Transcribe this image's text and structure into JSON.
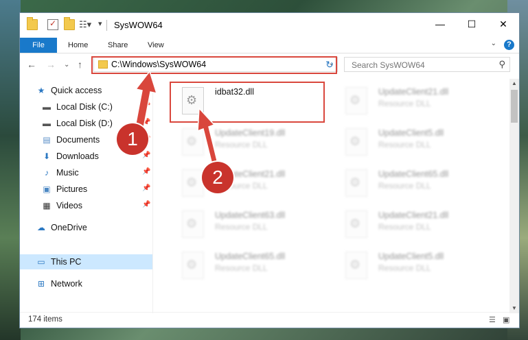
{
  "window": {
    "title": "SysWOW64"
  },
  "window_controls": {
    "minimize": "—",
    "maximize": "☐",
    "close": "✕"
  },
  "ribbon": {
    "tabs": [
      "File",
      "Home",
      "Share",
      "View"
    ]
  },
  "address": {
    "path": "C:\\Windows\\SysWOW64"
  },
  "search": {
    "placeholder": "Search SysWOW64"
  },
  "sidebar": {
    "items": [
      {
        "label": "Quick access",
        "icon": "★",
        "pinned": false
      },
      {
        "label": "Local Disk (C:)",
        "icon": "▬",
        "pinned": true
      },
      {
        "label": "Local Disk (D:)",
        "icon": "▬",
        "pinned": true
      },
      {
        "label": "Documents",
        "icon": "▤",
        "pinned": true
      },
      {
        "label": "Downloads",
        "icon": "⬇",
        "pinned": true
      },
      {
        "label": "Music",
        "icon": "♪",
        "pinned": true
      },
      {
        "label": "Pictures",
        "icon": "▣",
        "pinned": true
      },
      {
        "label": "Videos",
        "icon": "▦",
        "pinned": true
      },
      {
        "label": "OneDrive",
        "icon": "☁",
        "pinned": false
      },
      {
        "label": "This PC",
        "icon": "▭",
        "pinned": false
      },
      {
        "label": "Network",
        "icon": "⊞",
        "pinned": false
      }
    ]
  },
  "files": [
    {
      "name": "idbat32.dll",
      "type": ""
    },
    {
      "name": "UpdateClient21.dll",
      "type": "Resource DLL"
    },
    {
      "name": "UpdateClient19.dll",
      "type": "Resource DLL"
    },
    {
      "name": "UpdateClient5.dll",
      "type": "Resource DLL"
    },
    {
      "name": "UpdateClient21.dll",
      "type": "Resource DLL"
    },
    {
      "name": "UpdateClient65.dll",
      "type": "Resource DLL"
    },
    {
      "name": "UpdateClient63.dll",
      "type": "Resource DLL"
    },
    {
      "name": "UpdateClient21.dll",
      "type": "Resource DLL"
    },
    {
      "name": "UpdateClient65.dll",
      "type": "Resource DLL"
    },
    {
      "name": "UpdateClient5.dll",
      "type": "Resource DLL"
    }
  ],
  "status": {
    "item_count": "174 items"
  },
  "annotations": {
    "step1": "1",
    "step2": "2",
    "accent_color": "#d9463c"
  }
}
